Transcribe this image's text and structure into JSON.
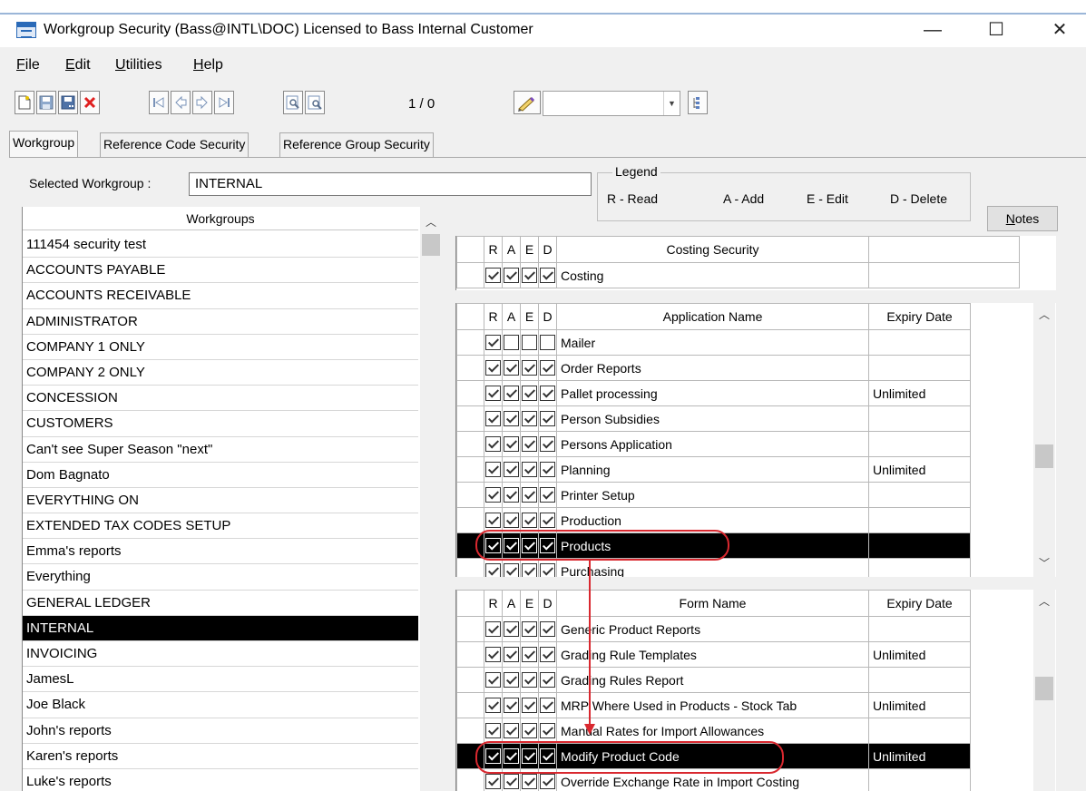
{
  "window": {
    "title": "Workgroup Security (Bass@INTL\\DOC) Licensed to Bass Internal Customer",
    "minimize_glyph": "—",
    "maximize_glyph": "☐",
    "close_glyph": "✕"
  },
  "menu": [
    {
      "lead": "F",
      "rest": "ile"
    },
    {
      "lead": "E",
      "rest": "dit"
    },
    {
      "lead": "U",
      "rest": "tilities"
    },
    {
      "lead": "H",
      "rest": "elp"
    }
  ],
  "toolbar": {
    "buttons": [
      "new-icon",
      "save-icon",
      "save-as-icon",
      "delete-icon",
      "first-record-icon",
      "previous-record-icon",
      "next-record-icon",
      "last-record-icon",
      "find-icon",
      "find-next-icon"
    ],
    "record_count": "1 / 0",
    "pen_icon": "pencil-icon",
    "combo_value": "",
    "tree_icon": "tree-icon"
  },
  "tabs": [
    "Workgroup",
    "Reference Code Security",
    "Reference Group Security"
  ],
  "selected_workgroup": {
    "label": "Selected Workgroup :",
    "value": "INTERNAL"
  },
  "legend": {
    "title": "Legend",
    "items": [
      "R - Read",
      "A - Add",
      "E - Edit",
      "D - Delete"
    ]
  },
  "notes": {
    "lead": "N",
    "rest": "otes"
  },
  "workgroups": {
    "header": "Workgroups",
    "items": [
      "111454 security test",
      "ACCOUNTS PAYABLE",
      "ACCOUNTS RECEIVABLE",
      "ADMINISTRATOR",
      "COMPANY 1 ONLY",
      "COMPANY 2 ONLY",
      "CONCESSION",
      "CUSTOMERS",
      "Can't see Super Season \"next\"",
      "Dom Bagnato",
      "EVERYTHING ON",
      "EXTENDED TAX CODES SETUP",
      "Emma's reports",
      "Everything",
      "GENERAL LEDGER",
      "INTERNAL",
      "INVOICING",
      "JamesL",
      "Joe Black",
      "John's reports",
      "Karen's reports",
      "Luke's reports"
    ],
    "selected_index": 15
  },
  "perm_headers": [
    "R",
    "A",
    "E",
    "D"
  ],
  "costing": {
    "header": "Costing Security",
    "rows": [
      {
        "name": "Costing",
        "perms": [
          true,
          true,
          true,
          true
        ]
      }
    ]
  },
  "applications": {
    "header": "Application Name",
    "expiry_header": "Expiry Date",
    "selected_index": 8,
    "rows": [
      {
        "name": "Mailer",
        "perms": [
          true,
          false,
          false,
          false
        ],
        "expiry": ""
      },
      {
        "name": "Order Reports",
        "perms": [
          true,
          true,
          true,
          true
        ],
        "expiry": ""
      },
      {
        "name": "Pallet processing",
        "perms": [
          true,
          true,
          true,
          true
        ],
        "expiry": "Unlimited"
      },
      {
        "name": "Person Subsidies",
        "perms": [
          true,
          true,
          true,
          true
        ],
        "expiry": ""
      },
      {
        "name": "Persons Application",
        "perms": [
          true,
          true,
          true,
          true
        ],
        "expiry": ""
      },
      {
        "name": "Planning",
        "perms": [
          true,
          true,
          true,
          true
        ],
        "expiry": "Unlimited"
      },
      {
        "name": "Printer Setup",
        "perms": [
          true,
          true,
          true,
          true
        ],
        "expiry": ""
      },
      {
        "name": "Production",
        "perms": [
          true,
          true,
          true,
          true
        ],
        "expiry": ""
      },
      {
        "name": "Products",
        "perms": [
          true,
          true,
          true,
          true
        ],
        "expiry": ""
      },
      {
        "name": "Purchasing",
        "perms": [
          true,
          true,
          true,
          true
        ],
        "expiry": ""
      }
    ]
  },
  "forms": {
    "header": "Form Name",
    "expiry_header": "Expiry Date",
    "selected_index": 5,
    "rows": [
      {
        "name": "Generic Product Reports",
        "perms": [
          true,
          true,
          true,
          true
        ],
        "expiry": ""
      },
      {
        "name": "Grading Rule Templates",
        "perms": [
          true,
          true,
          true,
          true
        ],
        "expiry": "Unlimited"
      },
      {
        "name": "Grading Rules Report",
        "perms": [
          true,
          true,
          true,
          true
        ],
        "expiry": ""
      },
      {
        "name": "MRP Where Used in Products - Stock Tab",
        "perms": [
          true,
          true,
          true,
          true
        ],
        "expiry": "Unlimited"
      },
      {
        "name": "Manual Rates for Import Allowances",
        "perms": [
          true,
          true,
          true,
          true
        ],
        "expiry": ""
      },
      {
        "name": "Modify Product Code",
        "perms": [
          true,
          true,
          true,
          true
        ],
        "expiry": "Unlimited"
      },
      {
        "name": "Override Exchange Rate in Import Costing",
        "perms": [
          true,
          true,
          true,
          true
        ],
        "expiry": ""
      }
    ]
  },
  "annotation": {
    "color": "#d9282f"
  }
}
